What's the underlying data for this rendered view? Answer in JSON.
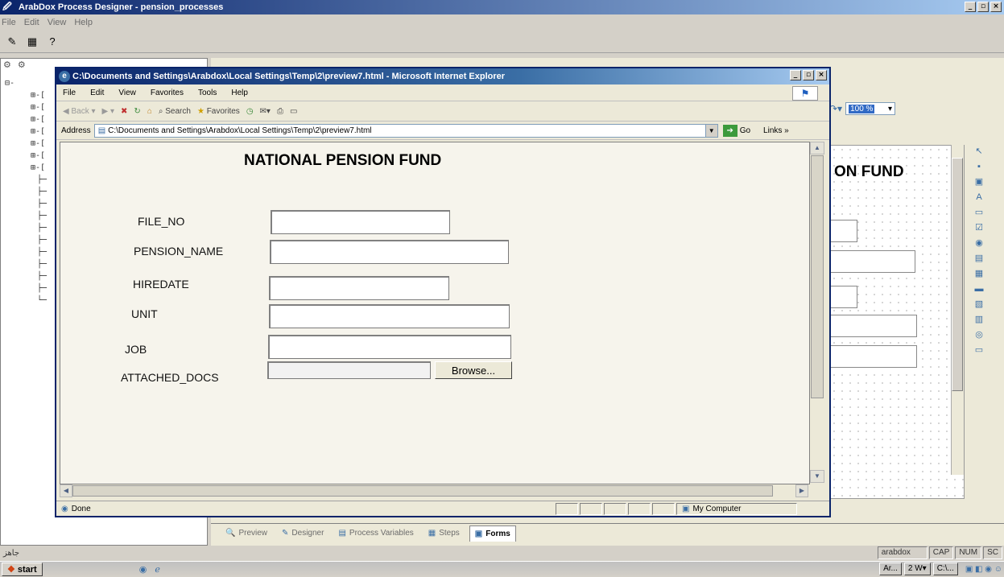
{
  "app": {
    "title": "ArabDox Process Designer - pension_processes",
    "menu": [
      "File",
      "Edit",
      "View",
      "Help"
    ],
    "help_glyph": "?"
  },
  "tree_rows": [
    "⊟-",
    "⊞-[",
    "⊞-[",
    "⊞-[",
    "⊞-[",
    "⊞-[",
    "⊞-[",
    "⊞-[",
    "├─",
    "├─",
    "├─",
    "├─",
    "├─",
    "├─",
    "├─",
    "├─",
    "├─",
    "├─",
    "└─"
  ],
  "designer": {
    "zoom": "100 %",
    "canvas_title": "ON FUND",
    "tabs": [
      {
        "label": "Preview",
        "icon": "preview-icon",
        "active": false
      },
      {
        "label": "Designer",
        "icon": "designer-icon",
        "active": false
      },
      {
        "label": "Process Variables",
        "icon": "variables-icon",
        "active": false
      },
      {
        "label": "Steps",
        "icon": "steps-icon",
        "active": false
      },
      {
        "label": "Forms",
        "icon": "forms-icon",
        "active": true
      }
    ]
  },
  "status": {
    "left": "جاهز",
    "user": "arabdox",
    "cap": "CAP",
    "num": "NUM",
    "scrl": "SC"
  },
  "taskbar": {
    "start": "start",
    "items": [
      "Ar...",
      "2 W▾",
      "C:\\..."
    ]
  },
  "ie": {
    "title": "C:\\Documents and Settings\\Arabdox\\Local Settings\\Temp\\2\\preview7.html - Microsoft Internet Explorer",
    "menu": [
      {
        "label": "File",
        "u": "F"
      },
      {
        "label": "Edit",
        "u": "E"
      },
      {
        "label": "View",
        "u": "V"
      },
      {
        "label": "Favorites",
        "u": "a"
      },
      {
        "label": "Tools",
        "u": "T"
      },
      {
        "label": "Help",
        "u": "H"
      }
    ],
    "toolbar": {
      "back": "Back",
      "search": "Search",
      "favorites": "Favorites"
    },
    "address_label": "Address",
    "address": "C:\\Documents and Settings\\Arabdox\\Local Settings\\Temp\\2\\preview7.html",
    "go": "Go",
    "links": "Links »",
    "status_done": "Done",
    "status_zone": "My Computer"
  },
  "form": {
    "title": "NATIONAL PENSION FUND",
    "fields": {
      "file_no": {
        "label": "FILE_NO",
        "value": ""
      },
      "pension_name": {
        "label": "PENSION_NAME",
        "value": ""
      },
      "hiredate": {
        "label": "HIREDATE",
        "value": ""
      },
      "unit": {
        "label": "UNIT",
        "value": ""
      },
      "job": {
        "label": "JOB",
        "value": ""
      },
      "attached_docs": {
        "label": "ATTACHED_DOCS",
        "value": ""
      }
    },
    "browse": "Browse..."
  }
}
